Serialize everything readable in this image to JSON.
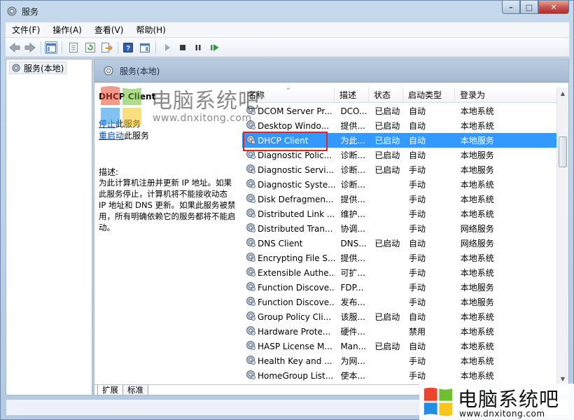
{
  "window": {
    "title": "服务",
    "min_glyph": "–",
    "max_glyph": "□",
    "close_glyph": "✕"
  },
  "menu": [
    "文件(F)",
    "操作(A)",
    "查看(V)",
    "帮助(H)"
  ],
  "tree": {
    "root": "服务(本地)"
  },
  "header": {
    "title": "服务(本地)"
  },
  "detail": {
    "service_name": "DHCP Client",
    "stop_link": "停止",
    "stop_suffix": "此服务",
    "restart_link": "重启动",
    "restart_suffix": "此服务",
    "desc_label": "描述:",
    "desc_text": "为此计算机注册并更新 IP 地址。如果此服务停止，计算机将不能接收动态 IP 地址和 DNS 更新。如果此服务被禁用，所有明确依赖它的服务都将不能启动。"
  },
  "columns": {
    "name": "名称",
    "desc": "描述",
    "status": "状态",
    "start": "启动类型",
    "logon": "登录为",
    "sort_glyph": "^"
  },
  "rows": [
    {
      "name": "DCOM Server Pr...",
      "desc": "DCO...",
      "status": "已启动",
      "start": "自动",
      "logon": "本地系统"
    },
    {
      "name": "Desktop Windo...",
      "desc": "提供...",
      "status": "已启动",
      "start": "自动",
      "logon": "本地系统"
    },
    {
      "name": "DHCP Client",
      "desc": "为此...",
      "status": "已启动",
      "start": "自动",
      "logon": "本地服务"
    },
    {
      "name": "Diagnostic Polic...",
      "desc": "诊断...",
      "status": "已启动",
      "start": "自动",
      "logon": "本地服务"
    },
    {
      "name": "Diagnostic Servi...",
      "desc": "诊断...",
      "status": "已启动",
      "start": "手动",
      "logon": "本地服务"
    },
    {
      "name": "Diagnostic Syste...",
      "desc": "诊断...",
      "status": "",
      "start": "手动",
      "logon": "本地系统"
    },
    {
      "name": "Disk Defragmen...",
      "desc": "提供...",
      "status": "",
      "start": "手动",
      "logon": "本地系统"
    },
    {
      "name": "Distributed Link ...",
      "desc": "维护...",
      "status": "",
      "start": "手动",
      "logon": "本地系统"
    },
    {
      "name": "Distributed Tran...",
      "desc": "协调...",
      "status": "",
      "start": "手动",
      "logon": "网络服务"
    },
    {
      "name": "DNS Client",
      "desc": "DNS...",
      "status": "已启动",
      "start": "自动",
      "logon": "网络服务"
    },
    {
      "name": "Encrypting File S...",
      "desc": "提供...",
      "status": "",
      "start": "手动",
      "logon": "本地系统"
    },
    {
      "name": "Extensible Authe...",
      "desc": "可扩...",
      "status": "",
      "start": "手动",
      "logon": "本地系统"
    },
    {
      "name": "Function Discove...",
      "desc": "FDP...",
      "status": "",
      "start": "手动",
      "logon": "本地服务"
    },
    {
      "name": "Function Discove...",
      "desc": "发布...",
      "status": "",
      "start": "手动",
      "logon": "本地服务"
    },
    {
      "name": "Group Policy Cli...",
      "desc": "该服...",
      "status": "已启动",
      "start": "自动",
      "logon": "本地系统"
    },
    {
      "name": "Hardware Prote...",
      "desc": "硬件...",
      "status": "",
      "start": "禁用",
      "logon": "本地系统"
    },
    {
      "name": "HASP License M...",
      "desc": "Man...",
      "status": "已启动",
      "start": "自动",
      "logon": "本地系统"
    },
    {
      "name": "Health Key and ...",
      "desc": "为网...",
      "status": "",
      "start": "手动",
      "logon": "本地系统"
    },
    {
      "name": "HomeGroup List...",
      "desc": "使本...",
      "status": "",
      "start": "手动",
      "logon": "本地系统"
    }
  ],
  "tabs": [
    "扩展",
    "标准"
  ],
  "watermark": {
    "brand": "电脑系统吧",
    "url": "www.dnxitong.com"
  },
  "colors": {
    "selection": "#3399ff",
    "highlight_box": "#d9262c",
    "link": "#0645ad"
  }
}
